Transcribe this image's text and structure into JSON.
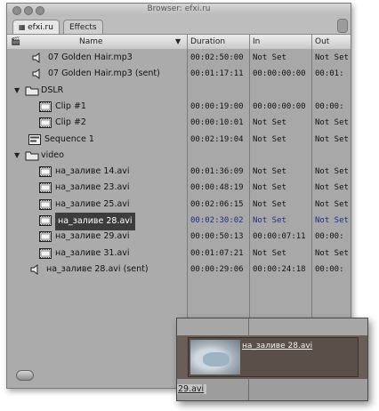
{
  "window": {
    "title": "Browser: efxi.ru"
  },
  "tabs": [
    {
      "label": "efxi.ru"
    },
    {
      "label": "Effects"
    }
  ],
  "columns": {
    "name": "Name",
    "duration": "Duration",
    "in": "In",
    "out": "Out"
  },
  "rows": [
    {
      "name": "07 Golden Hair.mp3",
      "duration": "00:02:50:00",
      "in": "Not Set",
      "out": "Not Set"
    },
    {
      "name": "07 Golden Hair.mp3 (sent)",
      "duration": "00:01:17:11",
      "in": "00:00:00:00",
      "out": "00:01:"
    },
    {
      "name": "DSLR",
      "duration": "",
      "in": "",
      "out": ""
    },
    {
      "name": "Clip #1",
      "duration": "00:00:19:00",
      "in": "00:00:00:00",
      "out": "00:00:"
    },
    {
      "name": "Clip #2",
      "duration": "00:00:10:01",
      "in": "Not Set",
      "out": "Not Set"
    },
    {
      "name": "Sequence 1",
      "duration": "00:02:19:04",
      "in": "Not Set",
      "out": "Not Set"
    },
    {
      "name": "video",
      "duration": "",
      "in": "",
      "out": ""
    },
    {
      "name": "на_заливе 14.avi",
      "duration": "00:01:36:09",
      "in": "Not Set",
      "out": "Not Set"
    },
    {
      "name": "на_заливе 23.avi",
      "duration": "00:00:48:19",
      "in": "Not Set",
      "out": "Not Set"
    },
    {
      "name": "на_заливе 25.avi",
      "duration": "00:02:06:15",
      "in": "Not Set",
      "out": "Not Set"
    },
    {
      "name": "на_заливе 28.avi",
      "duration": "00:02:30:02",
      "in": "Not Set",
      "out": "Not Set"
    },
    {
      "name": "на_заливе 29.avi",
      "duration": "00:00:50:13",
      "in": "00:00:07:11",
      "out": "00:00:"
    },
    {
      "name": "на_заливе 31.avi",
      "duration": "00:01:07:21",
      "in": "Not Set",
      "out": "Not Set"
    },
    {
      "name": "на_заливе 28.avi (sent)",
      "duration": "00:00:29:06",
      "in": "00:00:24:18",
      "out": "00:00:"
    }
  ],
  "selected_row_index": 10,
  "drag_preview": {
    "clip_label": "на_заливе 28.avi",
    "partial_name": "29.avi"
  },
  "colors": {
    "selected_text": "#1f2e8c",
    "selection_bg": "#3c3c3c",
    "drag_bg": "#6a5f58"
  }
}
